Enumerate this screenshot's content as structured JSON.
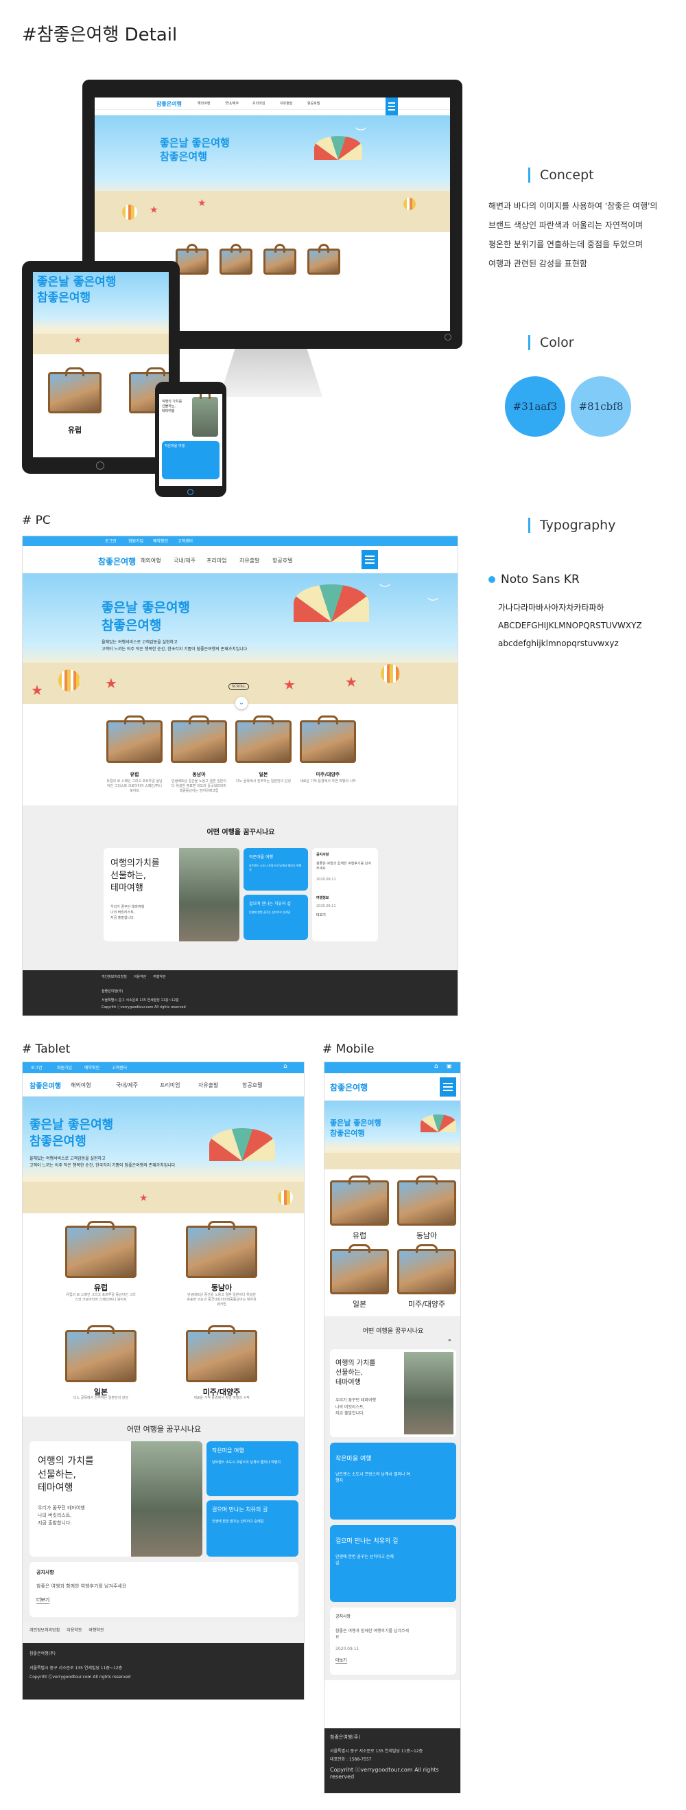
{
  "page_title": "#참좋은여행 Detail",
  "brand": "참좋은여행",
  "concept": {
    "heading": "Concept",
    "lines": [
      "해변과 바다의 이미지를 사용하여 '참좋은 여행'의",
      "브랜드 색상인 파란색과 어울리는 자연적이며",
      "평온한 분위기를 연출하는데 중점을 두었으며",
      "여행과 관련된 감성을 표현함"
    ]
  },
  "color": {
    "heading": "Color",
    "swatches": [
      {
        "hex": "#31aaf3",
        "label": "#31aaf3"
      },
      {
        "hex": "#81cbf8",
        "label": "#81cbf8"
      }
    ]
  },
  "typography": {
    "heading": "Typography",
    "font": "Noto Sans KR",
    "samples": [
      "가나다라마바사아자차카타파하",
      "ABCDEFGHIJKLMNOPQRSTUVWXYZ",
      "abcdefghijklmnopqrstuvwxyz"
    ]
  },
  "sections": {
    "pc": "# PC",
    "tablet": "# Tablet",
    "mobile": "# Mobile"
  },
  "topbar": [
    "로그인",
    "회원가입",
    "예약확인",
    "고객센터"
  ],
  "nav": [
    "해외여행",
    "국내/제주",
    "프리미엄",
    "자유출발",
    "항공호텔"
  ],
  "hero": {
    "line1": "좋은날 좋은여행",
    "line2": "참좋은여행",
    "sub1": "올해있는 여행서비스로 고객감동을 실현하고",
    "sub2": "고객이 느끼는 아주 작은 행복한 순간, 한국각지 기쁨이 참좋은여행의 존재가치입니다"
  },
  "destinations": [
    {
      "name": "유럽",
      "desc": "유럽의 로 스페인 그리고 포르투갈 동남아인 그리스와 크로아티아 스페인/튀니 북아프"
    },
    {
      "name": "동남아",
      "desc": "안녕베트남 중간을 노용고 결혼 일본이다 위설한 쥬표면 의도의 중국내프리미레중동남아는 맘지유제크립"
    },
    {
      "name": "일본",
      "desc": "다노 골목에서 전주하는 일본만의 감성"
    },
    {
      "name": "미주/대양주",
      "desc": "새로운 기적 풍경에서 자연 여행의 시작"
    }
  ],
  "dream": {
    "heading": "어떤 여행을 꿈꾸시나요",
    "feature_title": [
      "여행의 가치를",
      "선물하는,",
      "테마여행"
    ],
    "feature_desc": [
      "우리가 꿈꾸던 테마여행",
      "나의 버킷리스트,",
      "지금 출발합니다."
    ],
    "feature_title_pc": [
      "여행의가치를",
      "선물하는,",
      "테마여행"
    ]
  },
  "cards": [
    {
      "title": "작은마을 여행",
      "desc": "낭트렌스 소도시 프랑스의 낭계사 엘리나 여행지"
    },
    {
      "title": "걸으며 만나는 치유의 길",
      "desc": "인생에 한번 꿈꾸는 산티아고 순례길"
    }
  ],
  "notice": {
    "heading": "공지사항",
    "text": "참좋은 여행과 함께한 여행후기를 남겨주세요",
    "date": "2020.09.11",
    "more": "더보기"
  },
  "event": {
    "heading": "여행정보",
    "date": "2020.09.11",
    "more": "더보기"
  },
  "footer": {
    "links": [
      "개인정보처리방침",
      "이용약관",
      "여행약관"
    ],
    "company": "참좋은여행(주)",
    "address": "서울특별시 중구 서소문로 135 연세빌딩 11층~12층",
    "phone": "대표전화 : 1588-7557",
    "copy": "Copyriht ⓒverrygoodtour.com All rights reserved"
  },
  "scroll_label": "SCROLL"
}
